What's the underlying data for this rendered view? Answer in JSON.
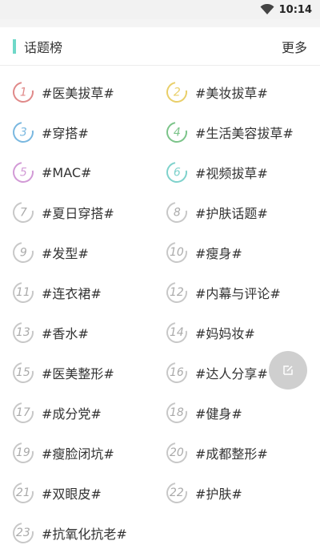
{
  "status_bar": {
    "time": "10:14"
  },
  "header": {
    "title": "话题榜",
    "more": "更多"
  },
  "topics": [
    {
      "rank": "1",
      "label": "#医美拔草#",
      "color": "#e08a8a"
    },
    {
      "rank": "2",
      "label": "#美妆拔草#",
      "color": "#e9cf6a"
    },
    {
      "rank": "3",
      "label": "#穿搭#",
      "color": "#7ab8e0"
    },
    {
      "rank": "4",
      "label": "#生活美容拔草#",
      "color": "#7cc48a"
    },
    {
      "rank": "5",
      "label": "#MAC#",
      "color": "#d29ad6"
    },
    {
      "rank": "6",
      "label": "#视频拔草#",
      "color": "#7fd2cc"
    },
    {
      "rank": "7",
      "label": "#夏日穿搭#",
      "color": "#c8c8c8"
    },
    {
      "rank": "8",
      "label": "#护肤话题#",
      "color": "#c8c8c8"
    },
    {
      "rank": "9",
      "label": "#发型#",
      "color": "#c8c8c8"
    },
    {
      "rank": "10",
      "label": "#瘦身#",
      "color": "#c8c8c8"
    },
    {
      "rank": "11",
      "label": "#连衣裙#",
      "color": "#c8c8c8"
    },
    {
      "rank": "12",
      "label": "#内幕与评论#",
      "color": "#c8c8c8"
    },
    {
      "rank": "13",
      "label": "#香水#",
      "color": "#c8c8c8"
    },
    {
      "rank": "14",
      "label": "#妈妈妆#",
      "color": "#c8c8c8"
    },
    {
      "rank": "15",
      "label": "#医美整形#",
      "color": "#c8c8c8"
    },
    {
      "rank": "16",
      "label": "#达人分享#",
      "color": "#c8c8c8"
    },
    {
      "rank": "17",
      "label": "#成分党#",
      "color": "#c8c8c8"
    },
    {
      "rank": "18",
      "label": "#健身#",
      "color": "#c8c8c8"
    },
    {
      "rank": "19",
      "label": "#瘦脸闭坑#",
      "color": "#c8c8c8"
    },
    {
      "rank": "20",
      "label": "#成都整形#",
      "color": "#c8c8c8"
    },
    {
      "rank": "21",
      "label": "#双眼皮#",
      "color": "#c8c8c8"
    },
    {
      "rank": "22",
      "label": "#护肤#",
      "color": "#c8c8c8"
    },
    {
      "rank": "23",
      "label": "#抗氧化抗老#",
      "color": "#c8c8c8"
    }
  ],
  "fab": {
    "icon": "edit-icon"
  }
}
